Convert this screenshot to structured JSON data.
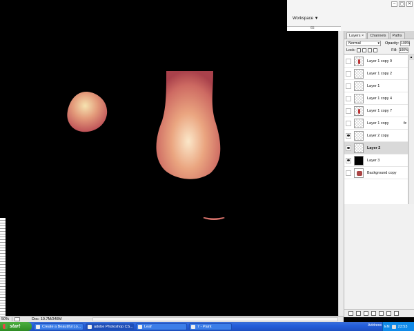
{
  "window": {
    "controls": [
      "–",
      "▢",
      "✕"
    ],
    "workspace_label": "Workspace ▼",
    "ruler_number": "65"
  },
  "layers_panel": {
    "tabs": [
      "Layers ×",
      "Channels",
      "Paths"
    ],
    "blend_mode": "Normal",
    "opacity_label": "Opacity:",
    "opacity_value": "100%",
    "lock_label": "Lock:",
    "fill_label": "Fill:",
    "fill_value": "100%",
    "layers": [
      {
        "name": "Layer 1 copy 9",
        "visible": false,
        "thumb": "mark",
        "selected": false,
        "fx": ""
      },
      {
        "name": "Layer 1 copy 2",
        "visible": false,
        "thumb": "empty",
        "selected": false,
        "fx": ""
      },
      {
        "name": "Layer 1",
        "visible": false,
        "thumb": "empty",
        "selected": false,
        "fx": ""
      },
      {
        "name": "Layer 1 copy 4",
        "visible": false,
        "thumb": "empty",
        "selected": false,
        "fx": ""
      },
      {
        "name": "Layer 1 copy 7",
        "visible": false,
        "thumb": "mark",
        "selected": false,
        "fx": ""
      },
      {
        "name": "Layer 1 copy",
        "visible": false,
        "thumb": "empty",
        "selected": false,
        "fx": "fx"
      },
      {
        "name": "Layer 2 copy",
        "visible": true,
        "thumb": "empty",
        "selected": false,
        "fx": ""
      },
      {
        "name": "Layer 2",
        "visible": true,
        "thumb": "empty",
        "selected": true,
        "fx": ""
      },
      {
        "name": "Layer 3",
        "visible": true,
        "thumb": "black",
        "selected": false,
        "fx": ""
      },
      {
        "name": "Background copy",
        "visible": false,
        "thumb": "bgcopy",
        "selected": false,
        "fx": ""
      }
    ]
  },
  "status_bar": {
    "zoom": "50%",
    "doc_size": "Doc: 10.7M/348M"
  },
  "taskbar": {
    "start_label": "start",
    "tasks": [
      {
        "label": "Create a Beautiful Lo...",
        "active": false
      },
      {
        "label": "adobe Photoshop CS...",
        "active": true
      },
      {
        "label": "Leaf",
        "active": false
      },
      {
        "label": "7 - Paint",
        "active": false
      }
    ],
    "address_label": "Address",
    "language": "EN",
    "clock": "23:53"
  }
}
